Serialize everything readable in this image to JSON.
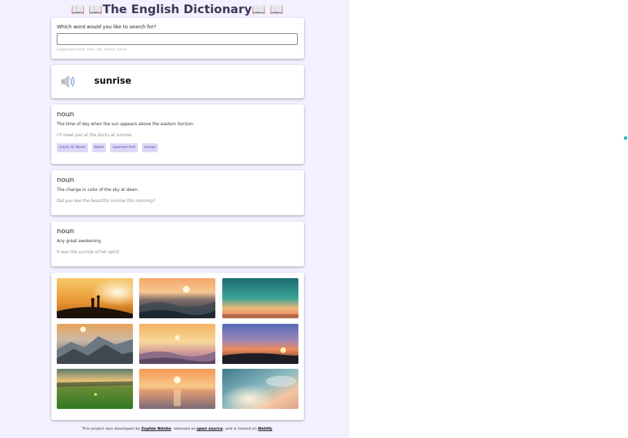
{
  "header": {
    "title": "The English Dictionary",
    "book_icon": "📖"
  },
  "search": {
    "question": "Which word would you like to search for?",
    "value": "",
    "hint": "suggested word: time, life, flower, travel"
  },
  "word": {
    "text": "sunrise",
    "speaker_icon": "speaker-icon"
  },
  "meanings": [
    {
      "part_of_speech": "noun",
      "definition": "The time of day when the sun appears above the eastern horizon.",
      "example": "I'll meet you at the docks at sunrise.",
      "synonyms": [
        "crack of dawn",
        "dawn",
        "sparrow fart",
        "sunup"
      ]
    },
    {
      "part_of_speech": "noun",
      "definition": "The change in color of the sky at dawn.",
      "example": "Did you see the beautiful sunrise this morning?"
    },
    {
      "part_of_speech": "noun",
      "definition": "Any great awakening.",
      "example": "It was the sunrise of her spirit."
    }
  ],
  "footer": {
    "prefix": "This project was developed by ",
    "author": "Sophie Ndobe",
    "middle": ", released as ",
    "source": "open source",
    "middle2": ", and is hosted on ",
    "host": "Netlify"
  },
  "colors": {
    "panel_bg": "#f3f0ff",
    "synonym_bg": "#dcd8f6",
    "synonym_text": "#5a56b3",
    "accent_dot": "#1fb5b5"
  }
}
